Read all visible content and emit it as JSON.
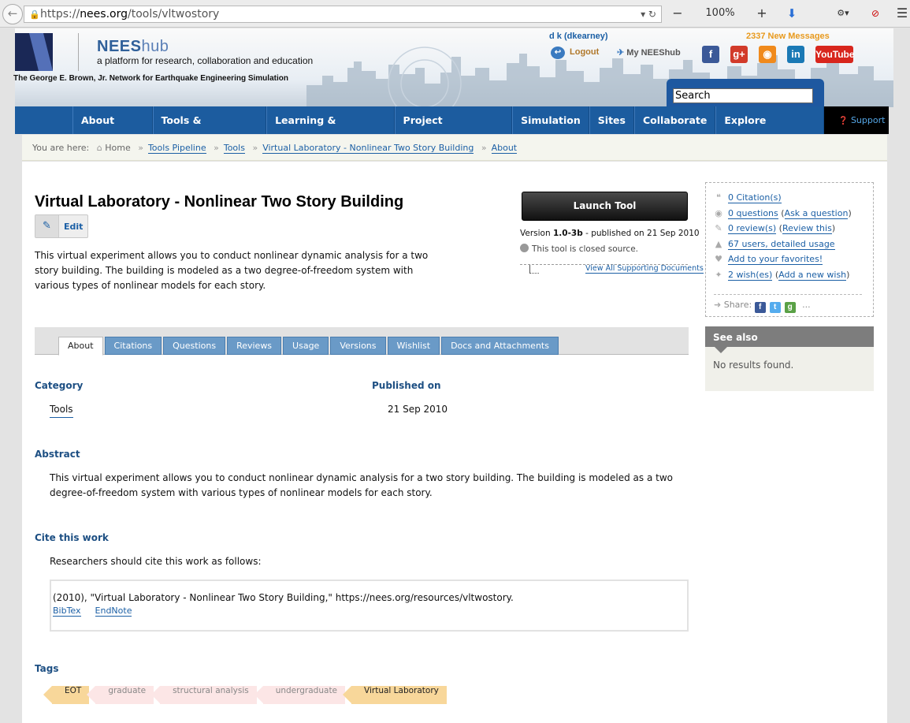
{
  "browser": {
    "url_prefix": "https://",
    "url_domain": "nees.org",
    "url_path": "/tools/vltwostory",
    "zoom": "100%"
  },
  "header": {
    "brand_main": "NEES",
    "brand_sub": "hub",
    "tagline": "a platform for research, collaboration and education",
    "network": "The George E. Brown, Jr. Network for Earthquake Engineering Simulation",
    "user": "d k (dkearney)",
    "messages": "2337 New Messages",
    "logout": "Logout",
    "my_neeshub": "My NEEShub",
    "search_value": "Search"
  },
  "nav": {
    "items": [
      "About NEES",
      "Tools & Resources",
      "Learning & Outreach",
      "Project Warehouse",
      "Simulation",
      "Sites",
      "Collaborate",
      "Explore NEEShub"
    ],
    "support": "Support"
  },
  "breadcrumb": {
    "label": "You are here:",
    "items": [
      "Home",
      "Tools Pipeline",
      "Tools",
      "Virtual Laboratory - Nonlinear Two Story Building",
      "About"
    ]
  },
  "tool": {
    "title": "Virtual Laboratory - Nonlinear Two Story Building",
    "edit": "Edit",
    "description": "This virtual experiment allows you to conduct nonlinear dynamic analysis for a two story building. The building is modeled as a two degree-of-freedom system with various types of nonlinear models for each story.",
    "launch": "Launch Tool",
    "version_label": "Version",
    "version": "1.0-3b",
    "published_text": "- published on 21 Sep 2010",
    "closed_source": "This tool is closed source.",
    "supporting_docs": "View All Supporting Documents"
  },
  "meta": {
    "citations": "0 Citation(s)",
    "questions": "0 questions",
    "ask": "Ask a question",
    "reviews": "0 review(s)",
    "review_this": "Review this",
    "usage": "67 users, detailed usage",
    "favorites": "Add to your favorites!",
    "wishes": "2 wish(es)",
    "new_wish": "Add a new wish",
    "share": "Share:",
    "share_more": "..."
  },
  "see_also": {
    "heading": "See also",
    "body": "No results found."
  },
  "tabs": [
    "About",
    "Citations",
    "Questions",
    "Reviews",
    "Usage",
    "Versions",
    "Wishlist",
    "Docs and Attachments"
  ],
  "about": {
    "category_heading": "Category",
    "category_value": "Tools",
    "published_heading": "Published on",
    "published_value": "21 Sep 2010",
    "abstract_heading": "Abstract",
    "abstract": "This virtual experiment allows you to conduct nonlinear dynamic analysis for a two story building. The building is modeled as a two degree-of-freedom system with various types of nonlinear models for each story.",
    "cite_heading": "Cite this work",
    "cite_intro": "Researchers should cite this work as follows:",
    "citation": "(2010), \"Virtual Laboratory - Nonlinear Two Story Building,\" https://nees.org/resources/vltwostory.",
    "bibtex": "BibTex",
    "endnote": "EndNote",
    "tags_heading": "Tags",
    "tags": [
      "EOT",
      "graduate",
      "structural analysis",
      "undergraduate",
      "Virtual Laboratory"
    ]
  },
  "colors": {
    "nav_blue": "#1c5c9f",
    "link_blue": "#1b5fa5",
    "heading_blue": "#1d4f83",
    "tab_blue": "#6a9ac7",
    "messages_orange": "#e89a1e",
    "tag_pink": "#fce6e6",
    "tag_highlight": "#f8d79a"
  }
}
